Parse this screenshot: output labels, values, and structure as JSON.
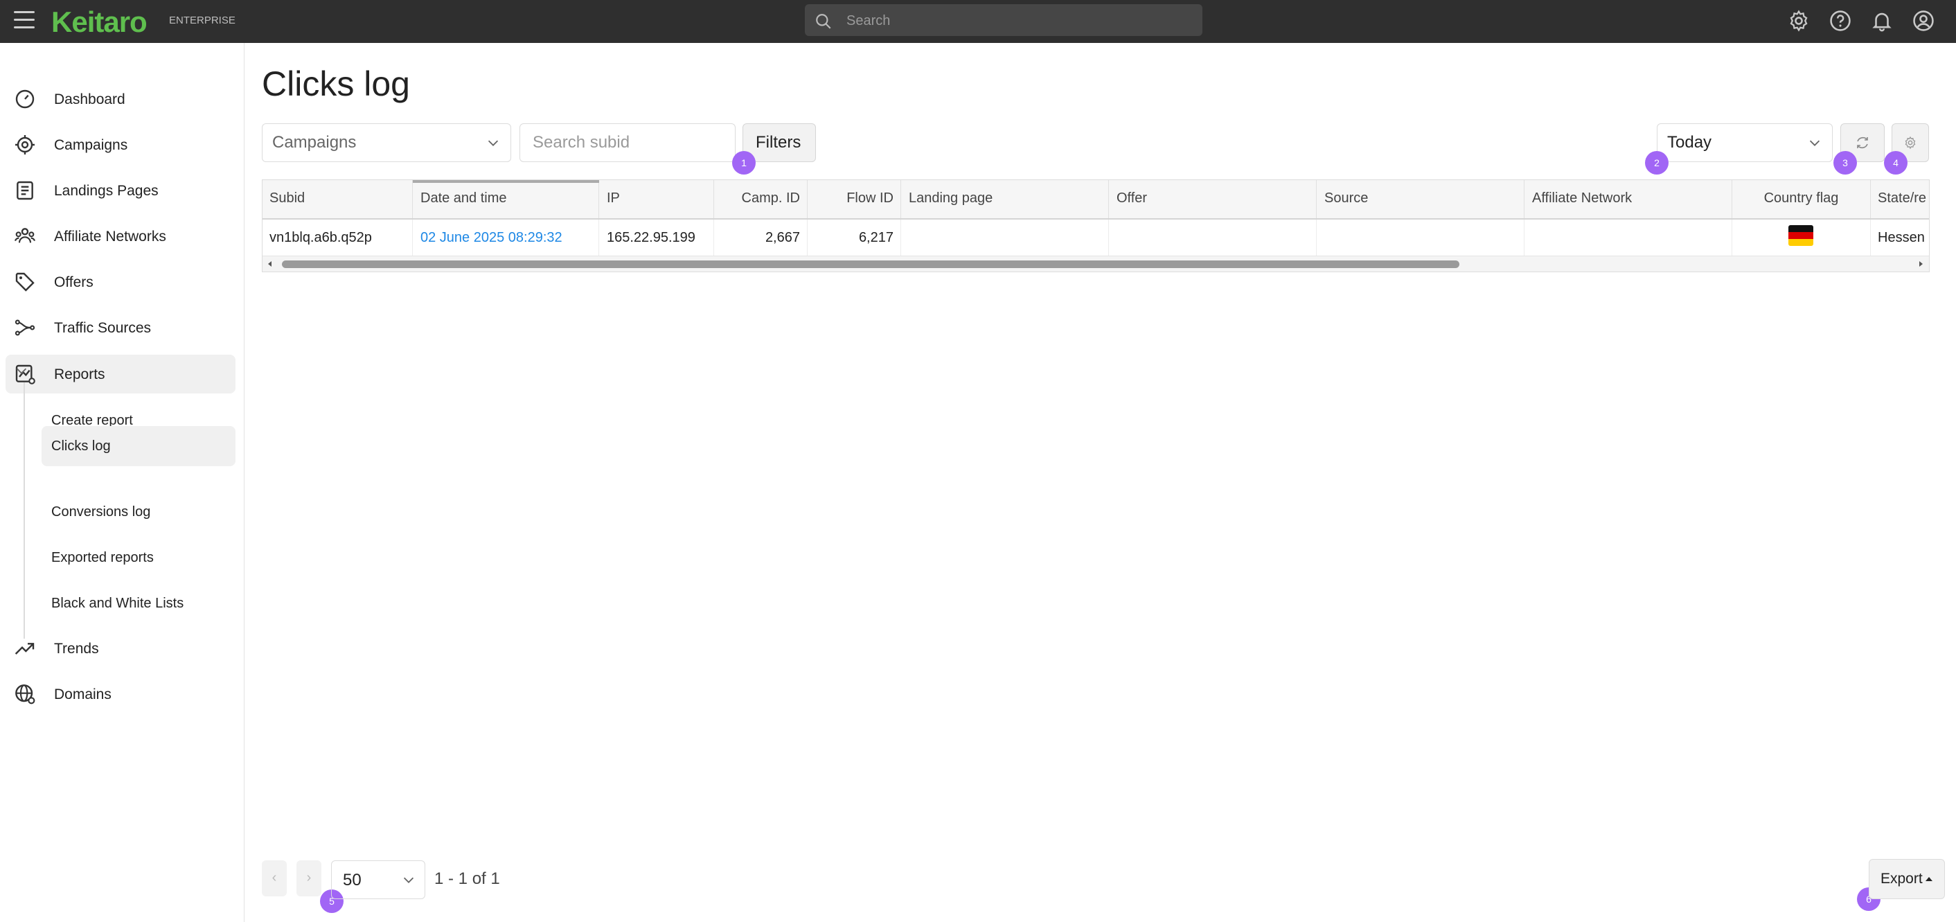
{
  "header": {
    "logo": "Keitaro",
    "edition": "ENTERPRISE",
    "search_placeholder": "Search"
  },
  "sidebar": {
    "items": [
      {
        "label": "Dashboard",
        "icon": "dashboard-icon"
      },
      {
        "label": "Campaigns",
        "icon": "target-icon"
      },
      {
        "label": "Landings Pages",
        "icon": "landing-page-icon"
      },
      {
        "label": "Affiliate Networks",
        "icon": "network-icon"
      },
      {
        "label": "Offers",
        "icon": "tag-icon"
      },
      {
        "label": "Traffic Sources",
        "icon": "traffic-source-icon"
      },
      {
        "label": "Reports",
        "icon": "reports-icon"
      },
      {
        "label": "Trends",
        "icon": "trend-icon"
      },
      {
        "label": "Domains",
        "icon": "domains-icon"
      }
    ],
    "report_subitems": [
      "Create report",
      "Clicks log",
      "Conversions log",
      "Exported reports",
      "Black and White Lists"
    ],
    "active_subitem": "Clicks log"
  },
  "page": {
    "title": "Clicks log",
    "campaigns_select": "Campaigns",
    "subid_placeholder": "Search subid",
    "filters_label": "Filters",
    "date_range": "Today"
  },
  "badges": [
    "1",
    "2",
    "3",
    "4",
    "5",
    "6"
  ],
  "table": {
    "columns": [
      "Subid",
      "Date and time",
      "IP",
      "Camp. ID",
      "Flow ID",
      "Landing page",
      "Offer",
      "Source",
      "Affiliate Network",
      "Country flag",
      "State/re"
    ],
    "rows": [
      {
        "subid": "vn1blq.a6b.q52p",
        "datetime": "02 June 2025 08:29:32",
        "ip": "165.22.95.199",
        "camp_id": "2,667",
        "flow_id": "6,217",
        "landing_page": "",
        "offer": "",
        "source": "",
        "affiliate_network": "",
        "country_flag": "germany-flag-icon",
        "state": "Hessen"
      }
    ]
  },
  "footer": {
    "prev": "‹",
    "next": "›",
    "page_size": "50",
    "page_info": "1 - 1 of 1",
    "export_label": "Export"
  },
  "colors": {
    "topbar": "#2f2f2f",
    "brand_green": "#5fbf4e",
    "badge": "#a166f5",
    "link": "#1e88e5"
  }
}
